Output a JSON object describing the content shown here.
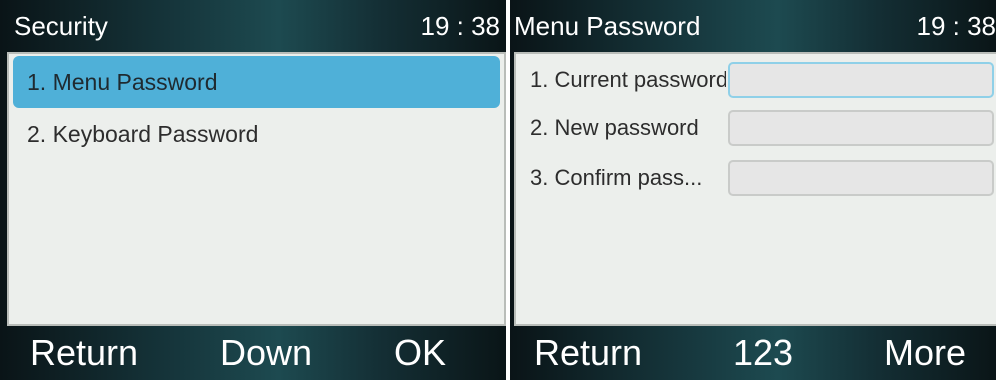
{
  "left_screen": {
    "title": "Security",
    "time": "19 : 38",
    "items": [
      {
        "label": "1. Menu Password"
      },
      {
        "label": "2. Keyboard Password"
      }
    ],
    "softkeys": [
      "Return",
      "Down",
      "OK"
    ]
  },
  "right_screen": {
    "title": "Menu Password",
    "time": "19 : 38",
    "fields": [
      {
        "label": "1. Current password",
        "value": ""
      },
      {
        "label": "2. New password",
        "value": ""
      },
      {
        "label": "3. Confirm pass...",
        "value": ""
      }
    ],
    "softkeys": [
      "Return",
      "123",
      "More"
    ]
  },
  "colors": {
    "selection": "#4fb0d8",
    "content_bg": "#ecefec",
    "text_dark": "#2d2d2d"
  }
}
